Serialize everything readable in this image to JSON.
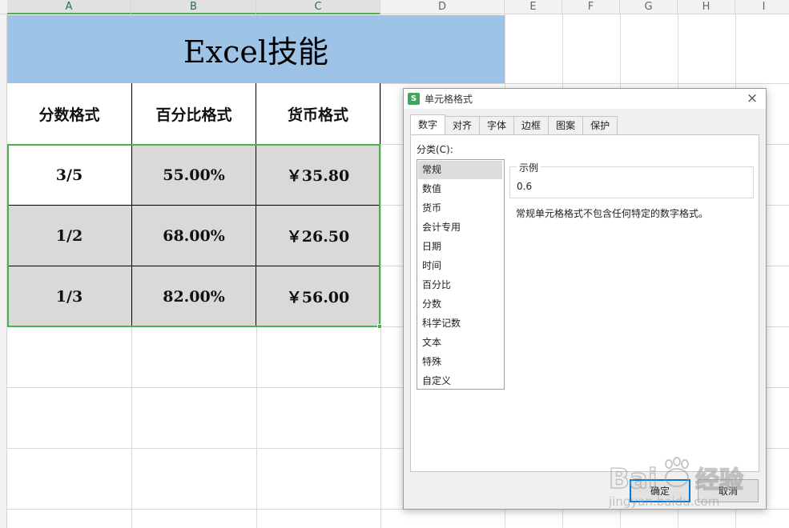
{
  "columns": [
    "A",
    "B",
    "C",
    "D",
    "E",
    "F",
    "G",
    "H",
    "I"
  ],
  "sheet": {
    "title": "Excel技能",
    "headers": [
      "分数格式",
      "百分比格式",
      "货币格式"
    ],
    "rows": [
      [
        "3/5",
        "55.00%",
        "￥35.80"
      ],
      [
        "1/2",
        "68.00%",
        "￥26.50"
      ],
      [
        "1/3",
        "82.00%",
        "￥56.00"
      ]
    ],
    "header_fill": "#9dc3e6",
    "shaded_fill": "#d9d9d9",
    "selection_color": "#4caf50"
  },
  "dialog": {
    "app_icon": "S",
    "title": "单元格格式",
    "close_glyph": "×",
    "tabs": [
      "数字",
      "对齐",
      "字体",
      "边框",
      "图案",
      "保护"
    ],
    "active_tab": "数字",
    "category_label": "分类(C):",
    "categories": [
      "常规",
      "数值",
      "货币",
      "会计专用",
      "日期",
      "时间",
      "百分比",
      "分数",
      "科学记数",
      "文本",
      "特殊",
      "自定义"
    ],
    "selected_category": "常规",
    "sample_label": "示例",
    "sample_value": "0.6",
    "description": "常规单元格格式不包含任何特定的数字格式。",
    "ok_label": "确定",
    "cancel_label": "取消"
  },
  "watermark": {
    "brand": "Bai",
    "brand_suffix": "经验",
    "url": "jingyan.baidu.com"
  }
}
